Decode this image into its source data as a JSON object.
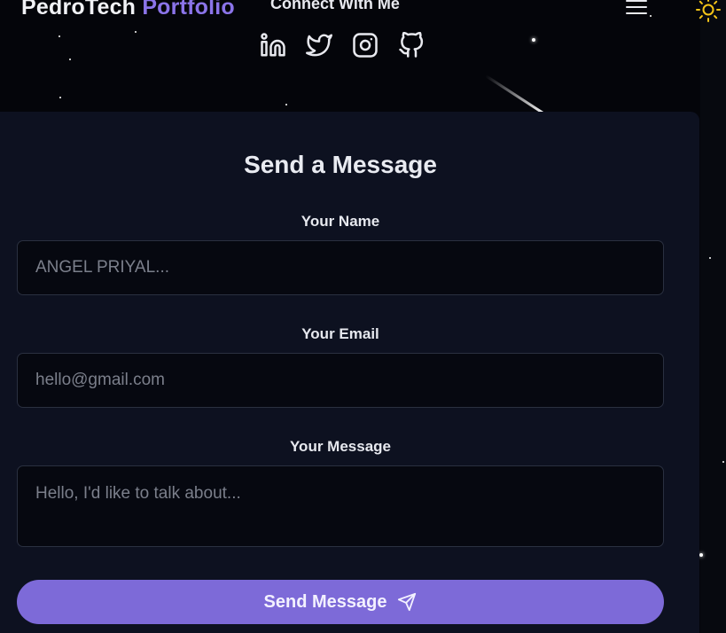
{
  "header": {
    "logo_name": "PedroTech",
    "logo_accent": "Portfolio",
    "connect_title": "Connect With Me",
    "social_icons": [
      "linkedin-icon",
      "twitter-icon",
      "instagram-icon",
      "github-icon"
    ],
    "menu_icon": "hamburger-menu-icon",
    "theme_icon": "sun-icon"
  },
  "contact_form": {
    "title": "Send a Message",
    "name_label": "Your Name",
    "name_placeholder": "ANGEL PRIYAL...",
    "email_label": "Your Email",
    "email_placeholder": "hello@gmail.com",
    "message_label": "Your Message",
    "message_placeholder": "Hello, I'd like to talk about...",
    "submit_label": "Send Message",
    "submit_icon": "send-icon"
  },
  "colors": {
    "background": "#04050a",
    "card": "#0d1120",
    "accent": "#8b74e9",
    "button": "#7d6ad8",
    "sun": "#f5c518"
  }
}
